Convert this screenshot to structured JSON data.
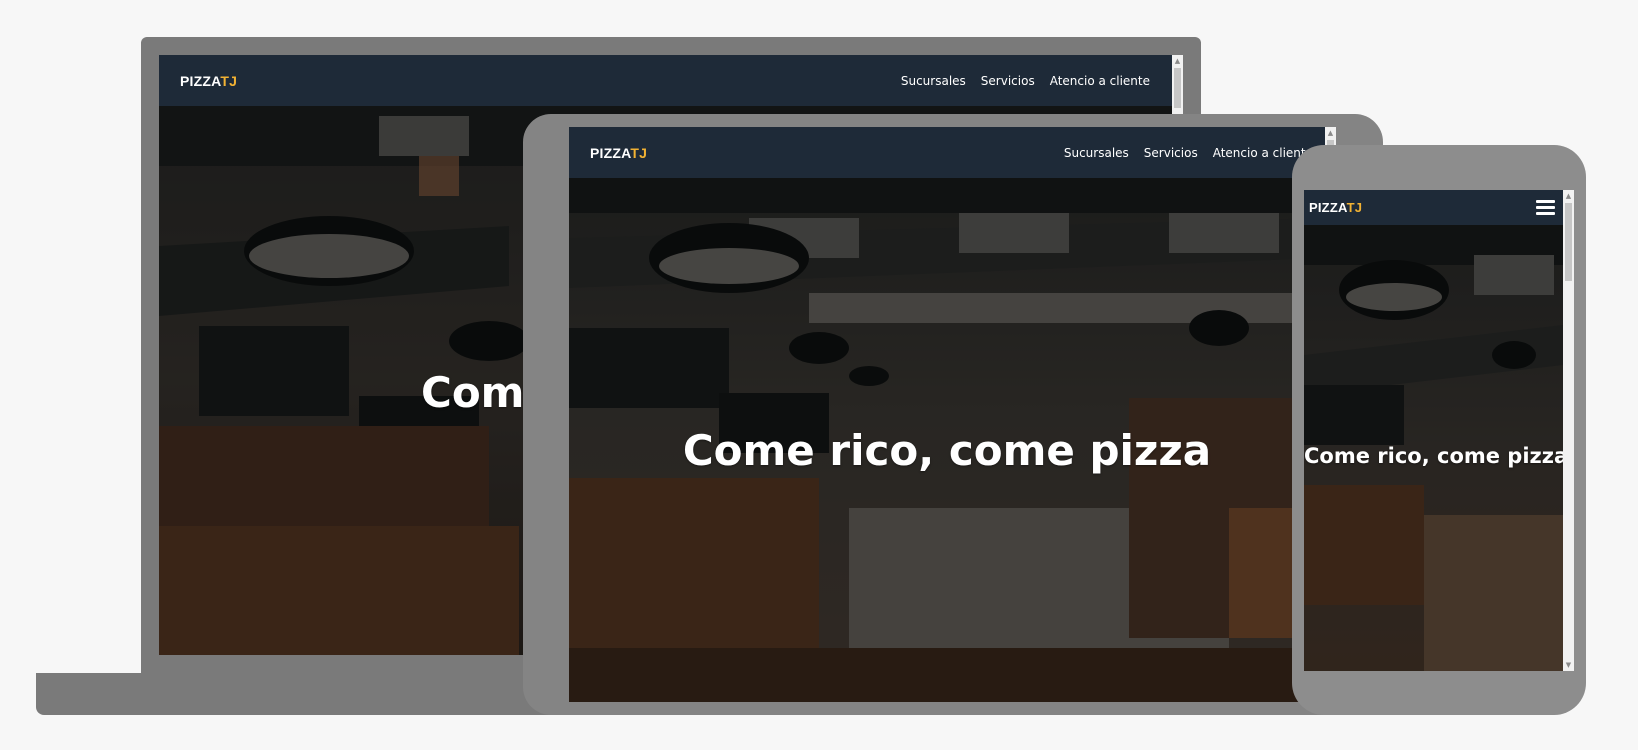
{
  "site": {
    "brand_main": "PIZZA",
    "brand_accent": "TJ",
    "accent_color": "#f2b233",
    "nav_color": "#1e2a38"
  },
  "nav": {
    "links": [
      "Sucursales",
      "Servicios",
      "Atencio a cliente"
    ]
  },
  "hero": {
    "title": "Come rico, come pizza",
    "laptop_title_visible": "Com"
  },
  "icons": {
    "menu": "hamburger-menu-icon",
    "scroll_up": "scroll-up-arrow-icon",
    "scroll_down": "scroll-down-arrow-icon"
  }
}
